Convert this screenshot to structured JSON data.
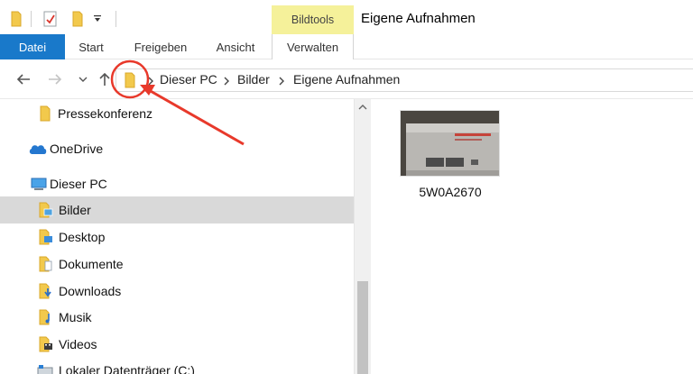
{
  "window": {
    "title": "Eigene Aufnahmen",
    "context_tab_group": "Bildtools"
  },
  "ribbon": {
    "tabs": [
      {
        "label": "Datei",
        "active": true
      },
      {
        "label": "Start"
      },
      {
        "label": "Freigeben"
      },
      {
        "label": "Ansicht"
      },
      {
        "label": "Verwalten"
      }
    ]
  },
  "address_bar": {
    "breadcrumbs": [
      "Dieser PC",
      "Bilder",
      "Eigene Aufnahmen"
    ]
  },
  "nav_pane": {
    "items": [
      {
        "label": "Pressekonferenz",
        "icon": "folder-icon"
      },
      {
        "label": "OneDrive",
        "icon": "onedrive-cloud-icon"
      },
      {
        "label": "Dieser PC",
        "icon": "computer-icon"
      },
      {
        "label": "Bilder",
        "icon": "pictures-folder-icon",
        "selected": true
      },
      {
        "label": "Desktop",
        "icon": "desktop-folder-icon"
      },
      {
        "label": "Dokumente",
        "icon": "documents-folder-icon"
      },
      {
        "label": "Downloads",
        "icon": "downloads-folder-icon"
      },
      {
        "label": "Musik",
        "icon": "music-folder-icon"
      },
      {
        "label": "Videos",
        "icon": "videos-folder-icon"
      },
      {
        "label": "Lokaler Datenträger (C:)",
        "icon": "local-drive-icon"
      }
    ]
  },
  "content": {
    "files": [
      {
        "name": "5W0A2670"
      }
    ]
  },
  "colors": {
    "accent": "#1979ca",
    "context_tab": "#f5f19a",
    "annotation": "#e8392b",
    "selection": "#d9d9d9"
  }
}
